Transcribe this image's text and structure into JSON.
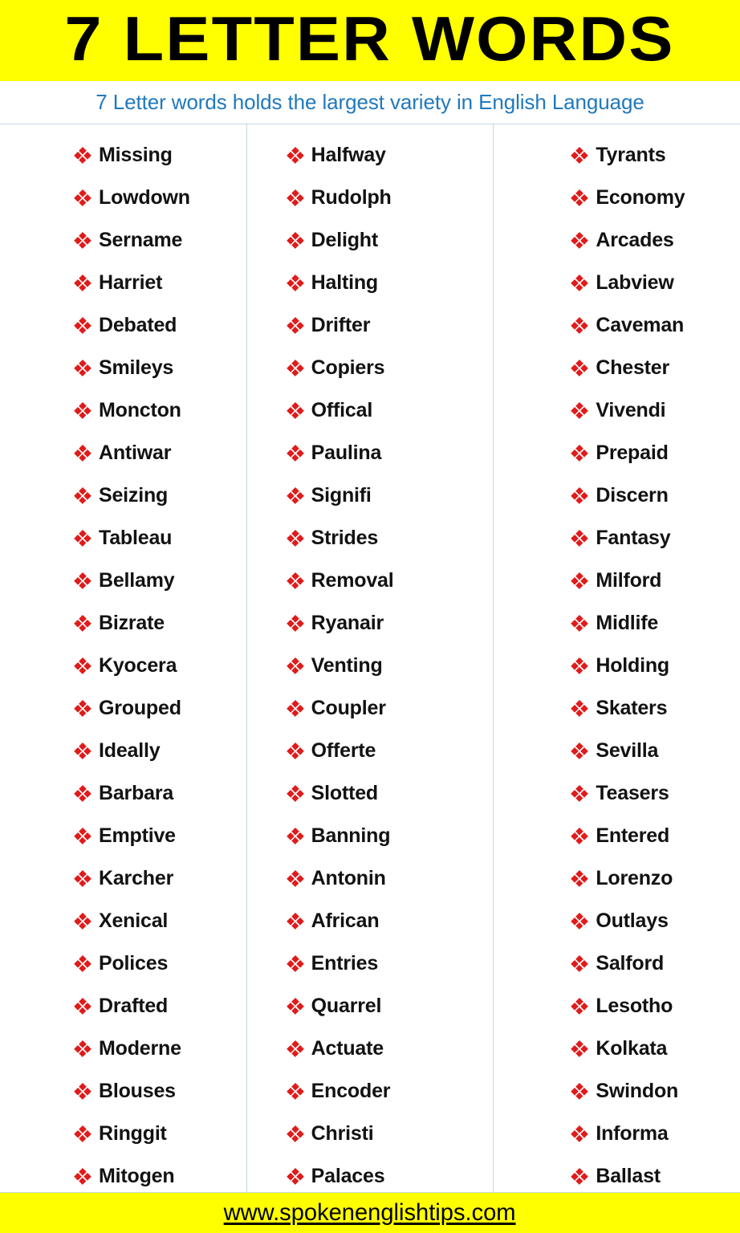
{
  "header": {
    "title": "7 LETTER WORDS",
    "subtitle": "7 Letter words holds the largest variety in English Language",
    "banner_color": "#ffff00",
    "subtitle_color": "#2079bd"
  },
  "list": {
    "bullet_icon": "four-diamond-bullet-icon",
    "bullet_color": "#e01b1b",
    "word_color": "#121212",
    "columns": [
      {
        "index": 1,
        "words": [
          "Missing",
          "Lowdown",
          "Sername",
          "Harriet",
          "Debated",
          "Smileys",
          "Moncton",
          "Antiwar",
          "Seizing",
          "Tableau",
          "Bellamy",
          "Bizrate",
          "Kyocera",
          "Grouped",
          "Ideally",
          "Barbara",
          "Emptive",
          "Karcher",
          "Xenical",
          "Polices",
          "Drafted",
          "Moderne",
          "Blouses",
          "Ringgit",
          "Mitogen"
        ]
      },
      {
        "index": 2,
        "words": [
          "Halfway",
          "Rudolph",
          "Delight",
          "Halting",
          "Drifter",
          "Copiers",
          "Offical",
          "Paulina",
          "Signifi",
          "Strides",
          "Removal",
          "Ryanair",
          "Venting",
          "Coupler",
          "Offerte",
          "Slotted",
          "Banning",
          "Antonin",
          "African",
          "Entries",
          "Quarrel",
          "Actuate",
          "Encoder",
          "Christi",
          "Palaces"
        ]
      },
      {
        "index": 3,
        "words": [
          "Tyrants",
          "Economy",
          "Arcades",
          "Labview",
          "Caveman",
          "Chester",
          "Vivendi",
          "Prepaid",
          "Discern",
          "Fantasy",
          "Milford",
          "Midlife",
          "Holding",
          "Skaters",
          "Sevilla",
          "Teasers",
          "Entered",
          "Lorenzo",
          "Outlays",
          "Salford",
          "Lesotho",
          "Kolkata",
          "Swindon",
          "Informa",
          "Ballast"
        ]
      }
    ]
  },
  "footer": {
    "url": "www.spokenenglishtips.com",
    "banner_color": "#ffff00"
  }
}
